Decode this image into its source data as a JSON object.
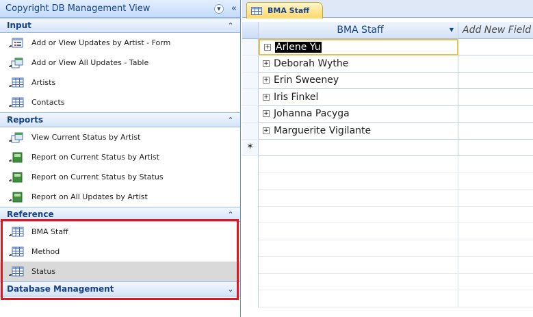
{
  "nav": {
    "title": "Copyright DB Management View",
    "dropdown_glyph": "▼",
    "collapse_glyph": "«",
    "groups": [
      {
        "label": "Input",
        "chevron": "≈",
        "items": [
          {
            "label": "Add or View Updates by Artist - Form",
            "icon": "form-icon"
          },
          {
            "label": "Add or View All Updates - Table",
            "icon": "query-icon"
          },
          {
            "label": "Artists",
            "icon": "table-icon"
          },
          {
            "label": "Contacts",
            "icon": "table-icon"
          }
        ]
      },
      {
        "label": "Reports",
        "chevron": "≈",
        "items": [
          {
            "label": "View Current Status by Artist",
            "icon": "query-icon"
          },
          {
            "label": "Report on Current Status by Artist",
            "icon": "report-icon"
          },
          {
            "label": "Report on Current Status by Status",
            "icon": "report-icon"
          },
          {
            "label": "Report on All Updates by Artist",
            "icon": "report-icon"
          }
        ]
      },
      {
        "label": "Reference",
        "chevron": "≈",
        "items": [
          {
            "label": "BMA Staff",
            "icon": "table-icon"
          },
          {
            "label": "Method",
            "icon": "table-icon"
          },
          {
            "label": "Status",
            "icon": "table-icon",
            "selected": true
          }
        ]
      },
      {
        "label": "Database Management",
        "chevron": "¥"
      }
    ]
  },
  "document": {
    "tab_label": "BMA Staff",
    "columns": [
      "BMA Staff",
      "Add New Field"
    ],
    "rows": [
      "Arlene Yu",
      "Deborah Wythe",
      "Erin Sweeney",
      "Iris Finkel",
      "Johanna Pacyga",
      "Marguerite Vigilante"
    ],
    "new_record_glyph": "*",
    "expander_glyph": "+"
  },
  "colors": {
    "accent": "#15428b",
    "highlight_box": "#e0171e",
    "active_tab": "#ffd86a"
  }
}
